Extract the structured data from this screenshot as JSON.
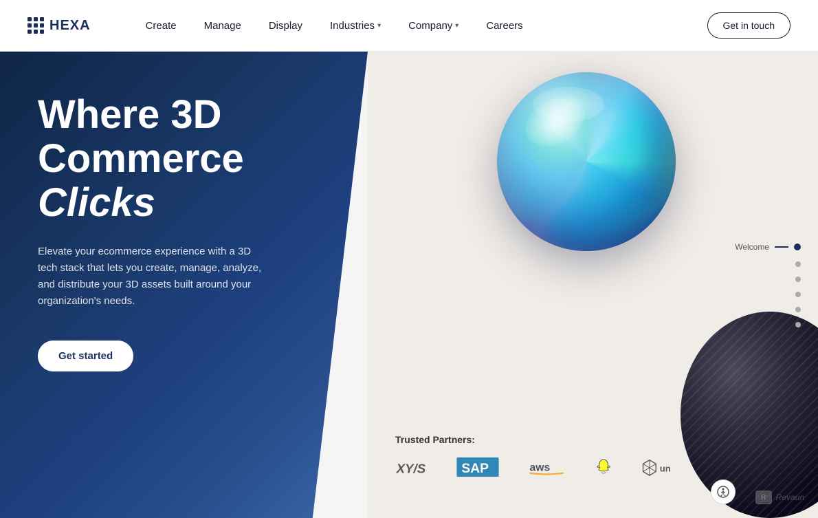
{
  "nav": {
    "logo_text": "HEXA",
    "links": [
      {
        "label": "Create",
        "has_dropdown": false
      },
      {
        "label": "Manage",
        "has_dropdown": false
      },
      {
        "label": "Display",
        "has_dropdown": false
      },
      {
        "label": "Industries",
        "has_dropdown": true
      },
      {
        "label": "Company",
        "has_dropdown": true
      },
      {
        "label": "Careers",
        "has_dropdown": false
      }
    ],
    "cta_label": "Get in touch"
  },
  "hero": {
    "title_line1": "Where 3D",
    "title_line2": "Commerce",
    "title_italic": "Clicks",
    "description": "Elevate your ecommerce experience with a 3D tech stack that lets you create, manage, analyze, and distribute your 3D assets built around your organization's needs.",
    "cta_label": "Get started"
  },
  "partners": {
    "label": "Trusted Partners:",
    "logos": [
      "XYS",
      "SAP",
      "aws",
      "Snapchat",
      "Unity"
    ]
  },
  "sidebar": {
    "welcome_label": "Welcome",
    "dots": [
      {
        "active": true
      },
      {
        "active": false
      },
      {
        "active": false
      },
      {
        "active": false
      },
      {
        "active": false
      },
      {
        "active": false
      }
    ]
  }
}
